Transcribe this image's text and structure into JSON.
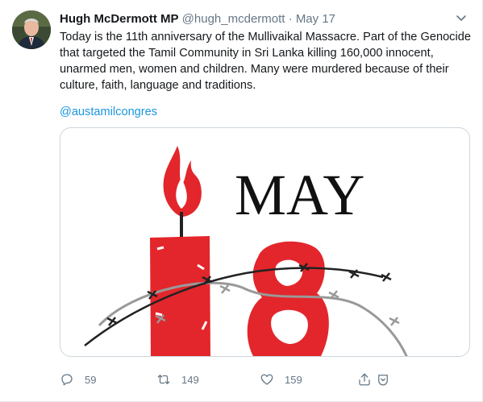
{
  "tweet": {
    "author_name": "Hugh McDermott MP",
    "handle": "@hugh_mcdermott",
    "separator": "·",
    "date": "May 17",
    "text": "Today is the 11th anniversary of the Mullivaikal Massacre. Part of the Genocide that targeted the Tamil Community in Sri Lanka killing 160,000 innocent, unarmed men, women and children. Many were murdered because of their culture, faith, language and traditions.",
    "mention": "@austamilcongres"
  },
  "media": {
    "heading": "MAY",
    "accent_color": "#e3262b"
  },
  "actions": {
    "replies": "59",
    "retweets": "149",
    "likes": "159"
  },
  "icons": [
    "chevron-down-icon",
    "reply-icon",
    "retweet-icon",
    "like-icon",
    "share-icon",
    "avatar-photo"
  ]
}
